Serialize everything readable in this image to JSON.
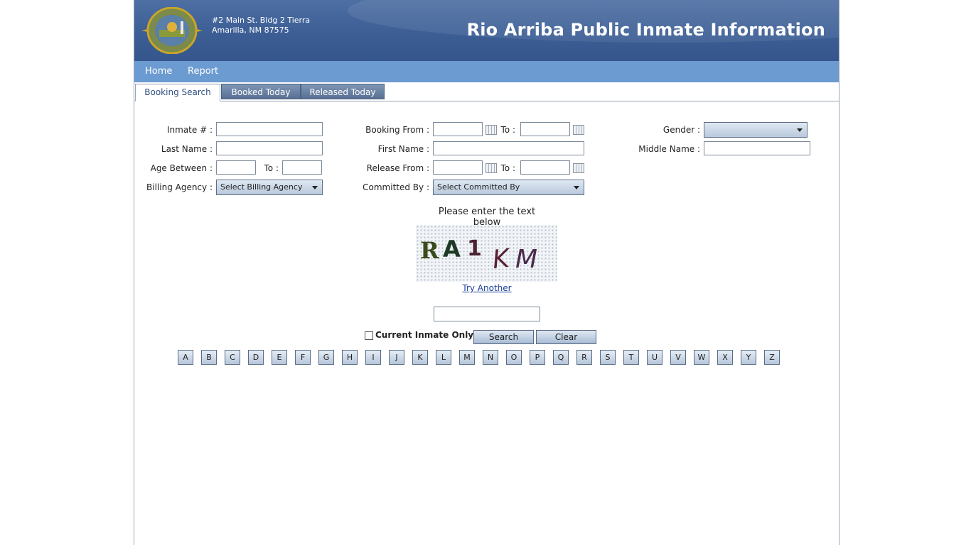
{
  "header": {
    "address_line1": "#2 Main St. Bldg 2 Tierra",
    "address_line2": "Amarilla, NM 87575",
    "title": "Rio Arriba Public Inmate Information"
  },
  "nav": {
    "home": "Home",
    "report": "Report"
  },
  "tabs": [
    "Booking Search",
    "Booked Today",
    "Released Today"
  ],
  "form": {
    "inmate_label": "Inmate # :",
    "last_name_label": "Last Name :",
    "age_between_label": "Age Between :",
    "age_to_label": "To :",
    "billing_agency_label": "Billing Agency :",
    "billing_agency_value": "Select Billing Agency",
    "booking_from_label": "Booking From :",
    "booking_to_label": "To :",
    "first_name_label": "First Name :",
    "release_from_label": "Release From :",
    "release_to_label": "To :",
    "committed_by_label": "Committed By :",
    "committed_by_value": "Select Committed By",
    "gender_label": "Gender :",
    "gender_value": "",
    "middle_name_label": "Middle Name :"
  },
  "captcha": {
    "prompt": "Please enter the text below",
    "text": "RA1KM",
    "try_another": "Try Another",
    "input_value": ""
  },
  "options": {
    "current_inmate_only": "Current Inmate Only",
    "current_inmate_checked": false
  },
  "buttons": {
    "search": "Search",
    "clear": "Clear"
  },
  "alphabet": [
    "A",
    "B",
    "C",
    "D",
    "E",
    "F",
    "G",
    "H",
    "I",
    "J",
    "K",
    "L",
    "M",
    "N",
    "O",
    "P",
    "Q",
    "R",
    "S",
    "T",
    "U",
    "V",
    "W",
    "X",
    "Y",
    "Z"
  ],
  "colors": {
    "header_bg": "#3c5e95",
    "nav_bg": "#6b9bd0",
    "link": "#1a3f9a"
  }
}
